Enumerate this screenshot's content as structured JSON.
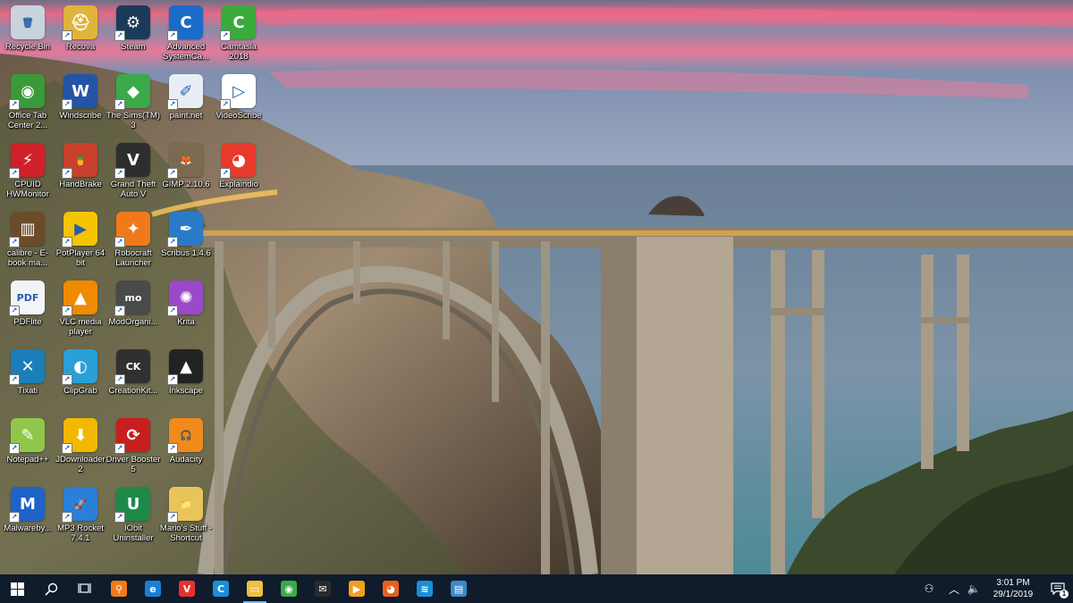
{
  "desktop": {
    "icons": [
      {
        "label": "Recycle Bin",
        "icon": "recycle-bin-icon",
        "glyph": "🗑",
        "bg": "#c8d3dc",
        "shortcut": false
      },
      {
        "label": "Office Tab Center 2...",
        "icon": "office-tab-icon",
        "glyph": "◉",
        "bg": "#3a9a3a",
        "shortcut": true
      },
      {
        "label": "CPUID HWMonitor",
        "icon": "hwmonitor-icon",
        "glyph": "⚡",
        "bg": "#d0202a",
        "shortcut": true
      },
      {
        "label": "calibre - E-book ma...",
        "icon": "calibre-icon",
        "glyph": "▥",
        "bg": "#6b4c2a",
        "shortcut": true
      },
      {
        "label": "PDFlite",
        "icon": "pdflite-icon",
        "glyph": "PDF",
        "bg": "#f2f4f7",
        "shortcut": true
      },
      {
        "label": "Tixati",
        "icon": "tixati-icon",
        "glyph": "✕",
        "bg": "#1a7fb8",
        "shortcut": true
      },
      {
        "label": "Notepad++",
        "icon": "notepadpp-icon",
        "glyph": "✎",
        "bg": "#8fc74a",
        "shortcut": true
      },
      {
        "label": "Malwareby...",
        "icon": "malwarebytes-icon",
        "glyph": "M",
        "bg": "#1d63c8",
        "shortcut": true
      },
      {
        "label": "Recuva",
        "icon": "recuva-icon",
        "glyph": "⛑",
        "bg": "#e0b43a",
        "shortcut": true
      },
      {
        "label": "Windscribe",
        "icon": "windscribe-icon",
        "glyph": "W",
        "bg": "#2454a6",
        "shortcut": true
      },
      {
        "label": "HandBrake",
        "icon": "handbrake-icon",
        "glyph": "🍍",
        "bg": "#c8402c",
        "shortcut": true
      },
      {
        "label": "PotPlayer 64 bit",
        "icon": "potplayer-icon",
        "glyph": "▶",
        "bg": "#f5c400",
        "shortcut": true
      },
      {
        "label": "VLC media player",
        "icon": "vlc-icon",
        "glyph": "▲",
        "bg": "#f08a00",
        "shortcut": true
      },
      {
        "label": "ClipGrab",
        "icon": "clipgrab-icon",
        "glyph": "◐",
        "bg": "#2aa0d8",
        "shortcut": true
      },
      {
        "label": "JDownloader 2",
        "icon": "jdownloader-icon",
        "glyph": "⬇",
        "bg": "#f3b800",
        "shortcut": true
      },
      {
        "label": "MP3 Rocket 7.4.1",
        "icon": "mp3rocket-icon",
        "glyph": "🚀",
        "bg": "#2a7fd8",
        "shortcut": true
      },
      {
        "label": "Steam",
        "icon": "steam-icon",
        "glyph": "⚙",
        "bg": "#1b3a5a",
        "shortcut": true
      },
      {
        "label": "The Sims(TM) 3",
        "icon": "sims3-icon",
        "glyph": "◆",
        "bg": "#3aaa4a",
        "shortcut": true
      },
      {
        "label": "Grand Theft Auto V",
        "icon": "gta5-icon",
        "glyph": "V",
        "bg": "#2e2e2e",
        "shortcut": true
      },
      {
        "label": "Robocraft Launcher",
        "icon": "robocraft-icon",
        "glyph": "✦",
        "bg": "#f07a1a",
        "shortcut": true
      },
      {
        "label": "ModOrgani...",
        "icon": "modorganizer-icon",
        "glyph": "mo",
        "bg": "#4a4a4a",
        "shortcut": true
      },
      {
        "label": "CreationKit...",
        "icon": "creationkit-icon",
        "glyph": "CK",
        "bg": "#303030",
        "shortcut": true
      },
      {
        "label": "Driver Booster 5",
        "icon": "driverbooster-icon",
        "glyph": "⟳",
        "bg": "#c81e1e",
        "shortcut": true
      },
      {
        "label": "IObit Uninstaller",
        "icon": "iobit-uninstaller-icon",
        "glyph": "U",
        "bg": "#1d8a4a",
        "shortcut": true
      },
      {
        "label": "Advanced SystemCa...",
        "icon": "advanced-systemcare-icon",
        "glyph": "C",
        "bg": "#1a6cc8",
        "shortcut": true
      },
      {
        "label": "paint.net",
        "icon": "paintnet-icon",
        "glyph": "✐",
        "bg": "#e8eef5",
        "shortcut": true
      },
      {
        "label": "GIMP 2.10.6",
        "icon": "gimp-icon",
        "glyph": "🦊",
        "bg": "#7a6a52",
        "shortcut": true
      },
      {
        "label": "Scribus 1.4.6",
        "icon": "scribus-icon",
        "glyph": "✒",
        "bg": "#2a7ac8",
        "shortcut": true
      },
      {
        "label": "Krita",
        "icon": "krita-icon",
        "glyph": "✺",
        "bg": "#9a4ac8",
        "shortcut": true
      },
      {
        "label": "Inkscape",
        "icon": "inkscape-icon",
        "glyph": "▲",
        "bg": "#222222",
        "shortcut": true
      },
      {
        "label": "Audacity",
        "icon": "audacity-icon",
        "glyph": "🎧",
        "bg": "#f08a1a",
        "shortcut": true
      },
      {
        "label": "Mario's Stuff - Shortcut",
        "icon": "folder-icon",
        "glyph": "📁",
        "bg": "#e8c45a",
        "shortcut": true
      },
      {
        "label": "Camtasia 2018",
        "icon": "camtasia-icon",
        "glyph": "C",
        "bg": "#3aaa3a",
        "shortcut": true
      },
      {
        "label": "VideoScribe",
        "icon": "videoscribe-icon",
        "glyph": "▷",
        "bg": "#ffffff",
        "shortcut": true
      },
      {
        "label": "Explaindio",
        "icon": "explaindio-icon",
        "glyph": "◕",
        "bg": "#e83a2a",
        "shortcut": true
      }
    ]
  },
  "taskbar": {
    "start": {
      "icon": "windows-start-icon"
    },
    "search": {
      "icon": "search-icon"
    },
    "taskview": {
      "icon": "task-view-icon"
    },
    "pinned": [
      {
        "icon": "everything-search-icon",
        "glyph": "⚲",
        "bg": "#f07a1a",
        "active": false
      },
      {
        "icon": "edge-icon",
        "glyph": "e",
        "bg": "#1a7fd8",
        "active": false
      },
      {
        "icon": "vivaldi-icon",
        "glyph": "V",
        "bg": "#e83030",
        "active": false
      },
      {
        "icon": "advanced-systemcare-icon",
        "glyph": "C",
        "bg": "#1a8fd8",
        "active": false
      },
      {
        "icon": "file-explorer-icon",
        "glyph": "▭",
        "bg": "#f0c040",
        "active": true
      },
      {
        "icon": "chrome-icon",
        "glyph": "◉",
        "bg": "#3aaa4a",
        "active": false
      },
      {
        "icon": "mail-icon",
        "glyph": "✉",
        "bg": "#2a2a2a",
        "active": false
      },
      {
        "icon": "potplayer-icon",
        "glyph": "▶",
        "bg": "#f0a020",
        "active": false
      },
      {
        "icon": "firefox-icon",
        "glyph": "◕",
        "bg": "#e8601a",
        "active": false
      },
      {
        "icon": "windscribe-icon",
        "glyph": "≋",
        "bg": "#1a8fd8",
        "active": false
      },
      {
        "icon": "control-panel-icon",
        "glyph": "▤",
        "bg": "#3a8ac8",
        "active": false
      }
    ],
    "tray": {
      "people_icon": "people-icon",
      "chevron_icon": "chevron-up-icon",
      "volume_icon": "volume-icon",
      "time": "3:01 PM",
      "date": "29/1/2019",
      "notification_count": "1"
    }
  }
}
